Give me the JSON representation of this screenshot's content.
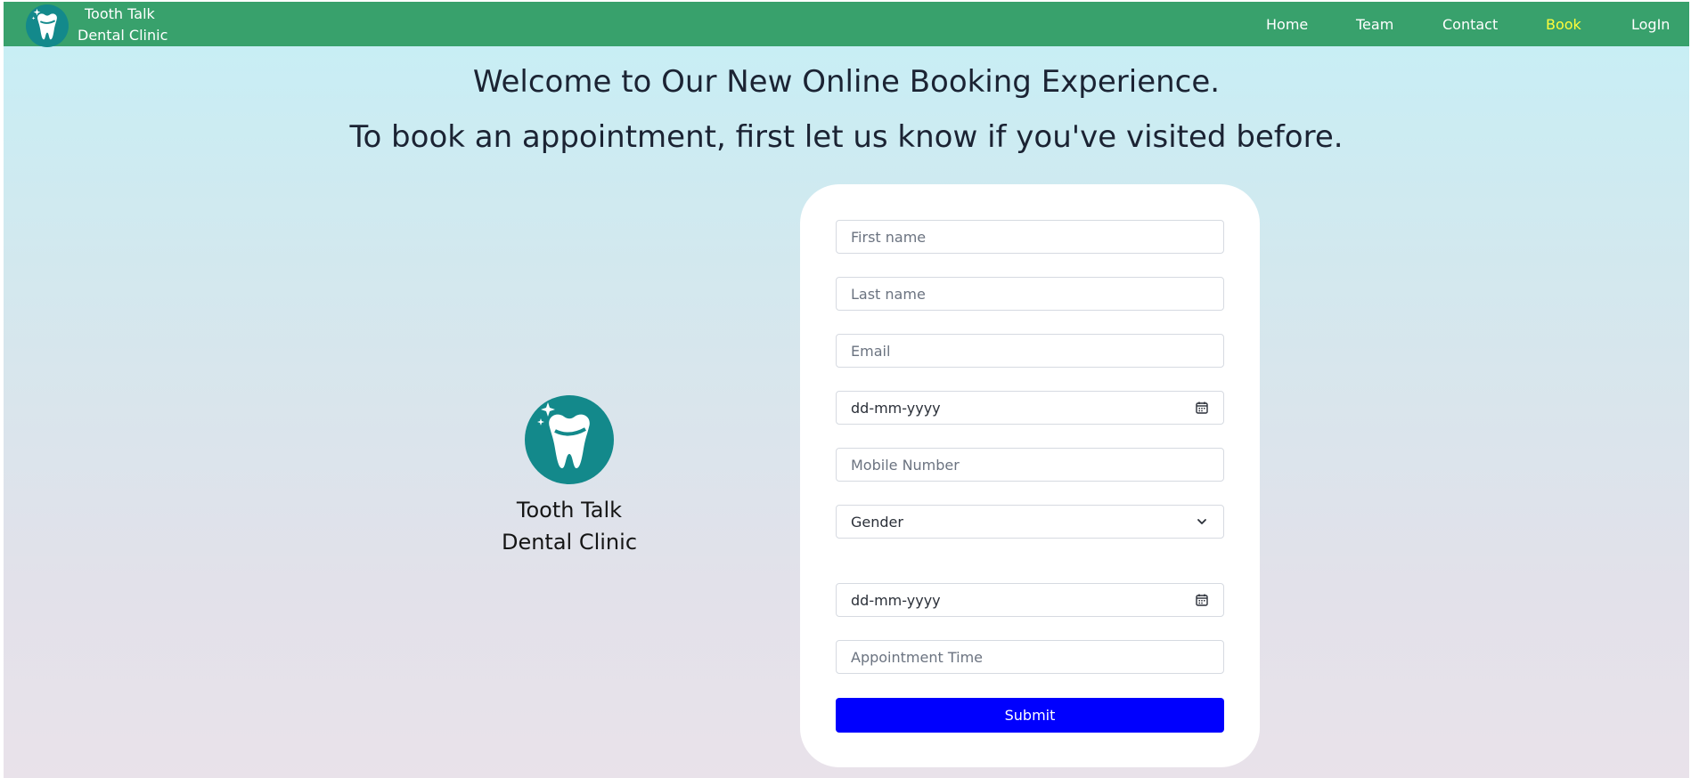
{
  "brand": {
    "line1": "Tooth Talk",
    "line2": "Dental Clinic"
  },
  "nav": {
    "items": [
      {
        "label": "Home",
        "active": false
      },
      {
        "label": "Team",
        "active": false
      },
      {
        "label": "Contact",
        "active": false
      },
      {
        "label": "Book",
        "active": true
      },
      {
        "label": "LogIn",
        "active": false
      }
    ]
  },
  "heading": {
    "line1": "Welcome to Our New Online Booking Experience.",
    "line2": "To book an appointment, first let us know if you've visited before."
  },
  "hero": {
    "name_line1": "Tooth Talk",
    "name_line2": "Dental Clinic"
  },
  "form": {
    "first_name": {
      "placeholder": "First name",
      "value": ""
    },
    "last_name": {
      "placeholder": "Last name",
      "value": ""
    },
    "email": {
      "placeholder": "Email",
      "value": ""
    },
    "dob": {
      "value": "dd-mm-yyyy",
      "icon": "calendar-icon"
    },
    "mobile": {
      "placeholder": "Mobile Number",
      "value": ""
    },
    "gender": {
      "selected": "Gender",
      "icon": "chevron-down-icon"
    },
    "appointment_date": {
      "value": "dd-mm-yyyy",
      "icon": "calendar-icon"
    },
    "appointment_time": {
      "placeholder": "Appointment Time",
      "value": ""
    },
    "submit_label": "Submit"
  },
  "colors": {
    "navbar": "#38a16c",
    "active_nav": "#fffd3a",
    "logo_circle": "#13898b",
    "submit": "#0000fe"
  }
}
